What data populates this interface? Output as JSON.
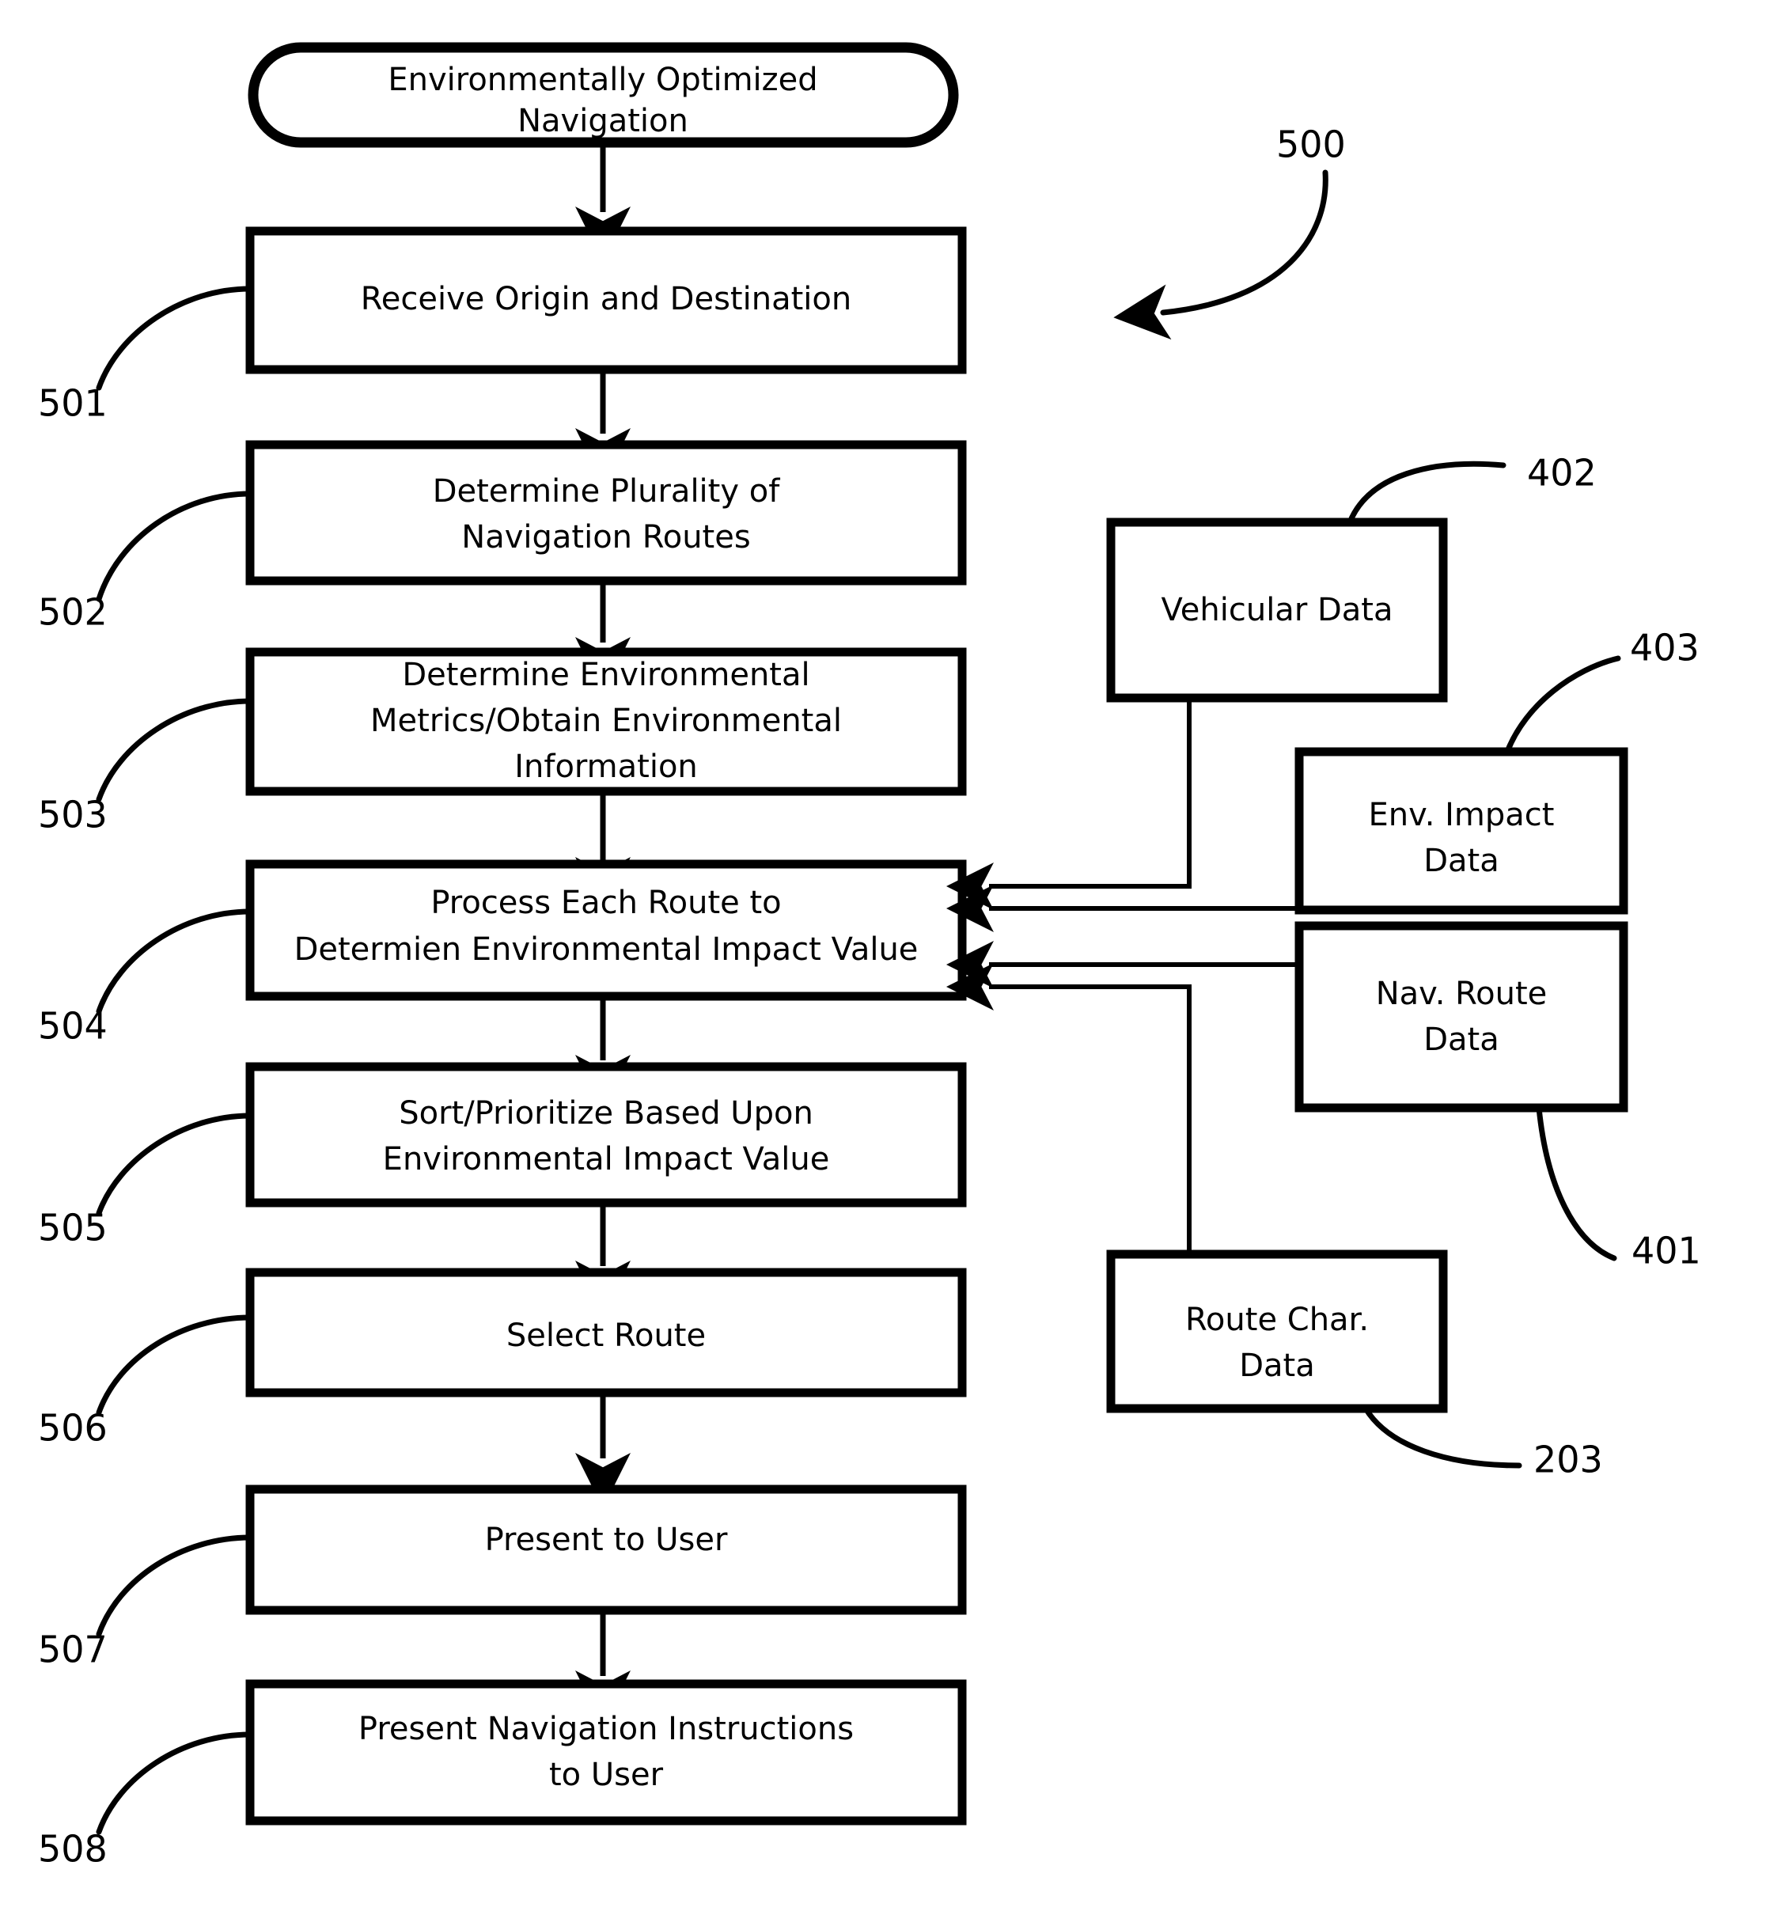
{
  "figure": {
    "number": "500",
    "type": "patent-flowchart",
    "title_ref": "500"
  },
  "terminator": {
    "label_line1": "Environmentally Optimized",
    "label_line2": "Navigation"
  },
  "process_steps": [
    {
      "ref": "501",
      "lines": [
        "Receive Origin and Destination"
      ]
    },
    {
      "ref": "502",
      "lines": [
        "Determine Plurality of",
        "Navigation Routes"
      ]
    },
    {
      "ref": "503",
      "lines": [
        "Determine Environmental",
        "Metrics/Obtain Environmental",
        "Information"
      ]
    },
    {
      "ref": "504",
      "lines": [
        "Process Each Route to",
        "Determien Environmental Impact Value"
      ]
    },
    {
      "ref": "505",
      "lines": [
        "Sort/Prioritize Based Upon",
        "Environmental Impact Value"
      ]
    },
    {
      "ref": "506",
      "lines": [
        "Select Route"
      ]
    },
    {
      "ref": "507",
      "lines": [
        "Present to User"
      ]
    },
    {
      "ref": "508",
      "lines": [
        "Present Navigation Instructions",
        "to User"
      ]
    }
  ],
  "data_sources": [
    {
      "ref": "402",
      "lines": [
        "Vehicular Data"
      ]
    },
    {
      "ref": "403",
      "lines": [
        "Env. Impact",
        "Data"
      ]
    },
    {
      "ref": "401",
      "lines": [
        "Nav. Route",
        "Data"
      ]
    },
    {
      "ref": "203",
      "lines": [
        "Route Char.",
        "Data"
      ]
    }
  ],
  "reference_numerals": {
    "fig": "500",
    "s501": "501",
    "s502": "502",
    "s503": "503",
    "s504": "504",
    "s505": "505",
    "s506": "506",
    "s507": "507",
    "s508": "508",
    "d402": "402",
    "d403": "403",
    "d401": "401",
    "d203": "203"
  },
  "colors": {
    "stroke": "#000000",
    "fill": "#ffffff",
    "background": "#ffffff"
  }
}
